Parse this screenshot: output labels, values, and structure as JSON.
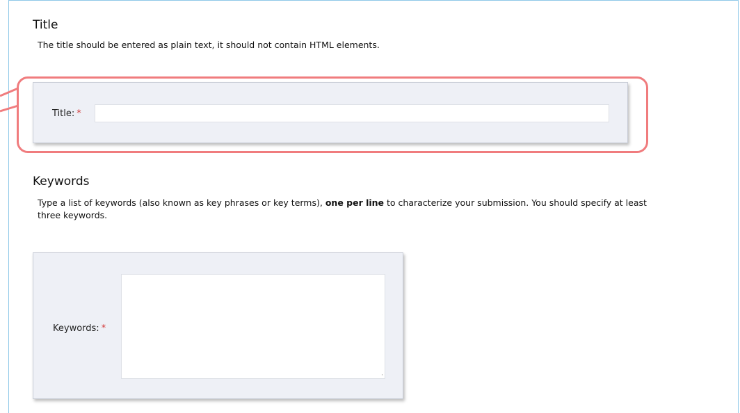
{
  "title_section": {
    "heading": "Title",
    "description": "The title should be entered as plain text, it should not contain HTML elements.",
    "field_label": "Title:",
    "required_mark": "*",
    "value": ""
  },
  "keywords_section": {
    "heading": "Keywords",
    "description_before": "Type a list of keywords (also known as key phrases or key terms), ",
    "description_bold": "one per line",
    "description_after": " to characterize your submission. You should specify at least three keywords.",
    "field_label": "Keywords:",
    "required_mark": "*",
    "value": ""
  },
  "colors": {
    "highlight": "#f07c7e",
    "panel_bg": "#eef0f6",
    "frame_border": "#8ec8e8",
    "required": "#d33b3b"
  }
}
